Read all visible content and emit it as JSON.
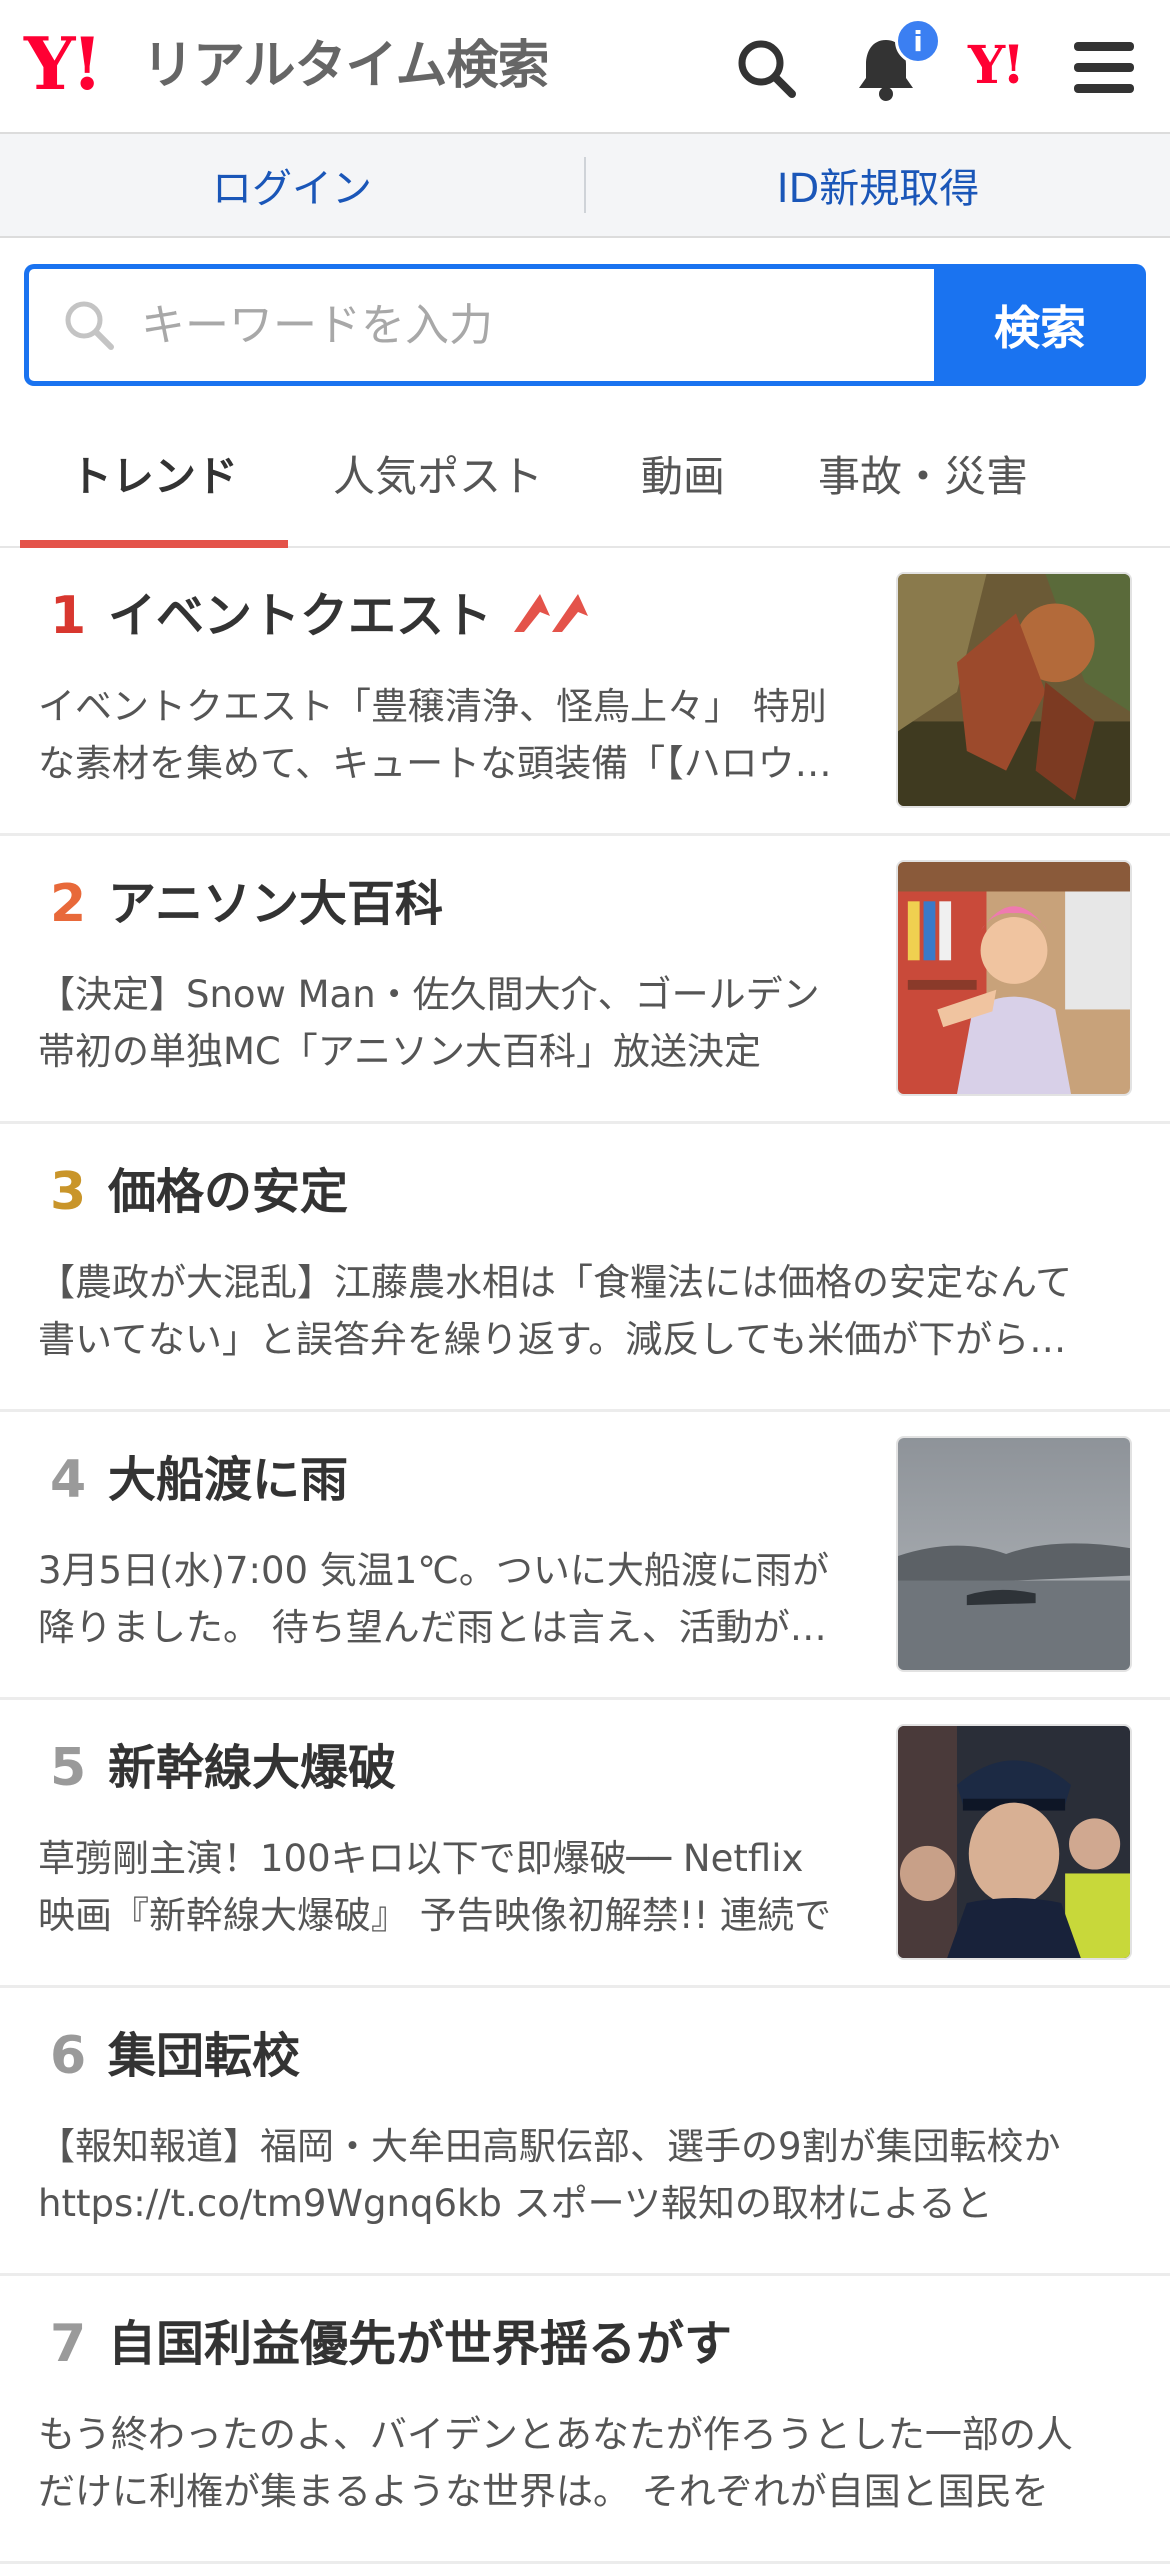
{
  "header": {
    "logo_mark": "Y!",
    "app_title": "リアルタイム検索",
    "notification_badge": "i",
    "brand_mark": "Y!",
    "icons": [
      "search-icon",
      "bell-icon",
      "yahoo-logo",
      "menu-icon"
    ]
  },
  "login_bar": {
    "login_label": "ログイン",
    "signup_label": "ID新規取得"
  },
  "search": {
    "placeholder": "キーワードを入力",
    "button_label": "検索"
  },
  "tabs": [
    {
      "label": "トレンド",
      "active": true
    },
    {
      "label": "人気ポスト",
      "active": false
    },
    {
      "label": "動画",
      "active": false
    },
    {
      "label": "事故・災害",
      "active": false
    }
  ],
  "trends": [
    {
      "rank": "1",
      "title": "イベントクエスト",
      "rising": true,
      "description": "イベントクエスト「豊穣清浄、怪鳥上々」 特別な素材を集めて、キュートな頭装備「【ハロウィン】",
      "rank_color": "#d8372f",
      "has_thumbnail": true,
      "thumbnail": "monster-scene"
    },
    {
      "rank": "2",
      "title": "アニソン大百科",
      "rising": false,
      "description": "【決定】Snow Man・佐久間大介、ゴールデン帯初の単独MC「アニソン大百科」放送決定",
      "rank_color": "#e8693a",
      "has_thumbnail": true,
      "thumbnail": "person-in-bookstore"
    },
    {
      "rank": "3",
      "title": "価格の安定",
      "rising": false,
      "description": "【農政が大混乱】江藤農水相は「食糧法には価格の安定なんて書いてない」と誤答弁を繰り返す。減反しても米価が下がらない",
      "rank_color": "#c9952a",
      "has_thumbnail": false
    },
    {
      "rank": "4",
      "title": "大船渡に雨",
      "rising": false,
      "description": "3月5日(水)7:00 気温1℃。ついに大船渡に雨が降りました。 待ち望んだ雨とは言え、活動が続く",
      "rank_color": "#9a9a9a",
      "has_thumbnail": true,
      "thumbnail": "rainy-bay"
    },
    {
      "rank": "5",
      "title": "新幹線大爆破",
      "rising": false,
      "description": "草彅剛主演！100キロ以下で即爆破── Netflix映画『新幹線大爆破』 予告映像初解禁!! 連続で",
      "rank_color": "#9a9a9a",
      "has_thumbnail": true,
      "thumbnail": "movie-still"
    },
    {
      "rank": "6",
      "title": "集団転校",
      "rising": false,
      "description": "【報知報道】福岡・大牟田高駅伝部、選手の9割が集団転校か https://t.co/tm9Wgnq6kb スポーツ報知の取材によると",
      "rank_color": "#9a9a9a",
      "has_thumbnail": false
    },
    {
      "rank": "7",
      "title": "自国利益優先が世界揺るがす",
      "rising": false,
      "description": "もう終わったのよ、バイデンとあなたが作ろうとした一部の人だけに利権が集まるような世界は。 それぞれが自国と国民を",
      "rank_color": "#9a9a9a",
      "has_thumbnail": false
    }
  ]
}
